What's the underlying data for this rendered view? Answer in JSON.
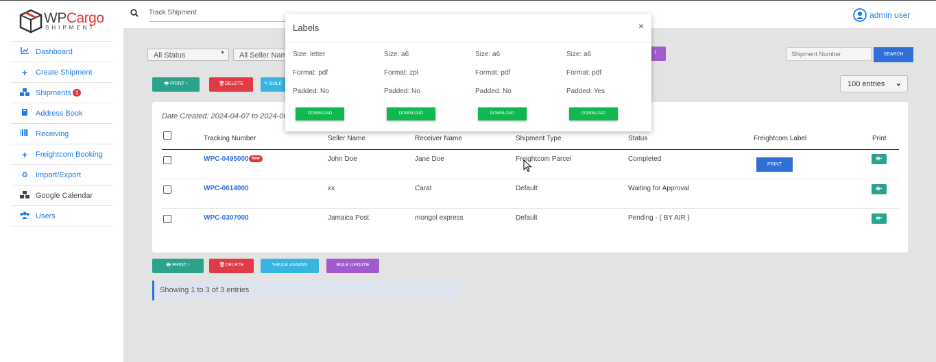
{
  "brand": {
    "name_part1": "WP",
    "name_part2": "Cargo",
    "tagline": "SHIPMENT"
  },
  "nav": [
    {
      "label": "Dashboard",
      "icon": "chart-line-icon"
    },
    {
      "label": "Create Shipment",
      "icon": "plus-icon"
    },
    {
      "label": "Shipments",
      "icon": "boxes-icon",
      "badge": "1"
    },
    {
      "label": "Address Book",
      "icon": "book-icon"
    },
    {
      "label": "Receiving",
      "icon": "barcode-icon"
    },
    {
      "label": "Freightcom Booking",
      "icon": "plus-icon"
    },
    {
      "label": "Import/Export",
      "icon": "recycle-icon"
    },
    {
      "label": "Google Calendar",
      "icon": "boxes-icon"
    },
    {
      "label": "Users",
      "icon": "users-icon"
    }
  ],
  "topbar": {
    "search_placeholder": "Track Shipment",
    "user": "admin user"
  },
  "filters": {
    "status": "All Status",
    "seller": "All Seller Name"
  },
  "toolbar": {
    "print": "PRINT",
    "delete": "DELETE",
    "bulk": "BULK",
    "bulk_assign": "BULK ASSIGN",
    "bulk_update": "BULK UPDATE"
  },
  "search": {
    "placeholder": "Shipment Number",
    "button": "SEARCH"
  },
  "entries": "100 entries",
  "date_created": "Date Created: 2024-04-07 to 2024-06-0",
  "columns": [
    "Tracking Number",
    "Seller Name",
    "Receiver Name",
    "Shipment Type",
    "Status",
    "Freightcom Label",
    "Print"
  ],
  "rows": [
    {
      "tracking": "WPC-0495000",
      "new": "New",
      "seller": "John Doe",
      "receiver": "Jane Doe",
      "type": "Freightcom Parcel",
      "status": "Completed",
      "label_btn": "PRINT"
    },
    {
      "tracking": "WPC-0614000",
      "seller": "xx",
      "receiver": "Carat",
      "type": "Default",
      "status": "Waiting for Approval"
    },
    {
      "tracking": "WPC-0307000",
      "seller": "Jamaica Post",
      "receiver": "mongol express",
      "type": "Default",
      "status": "Pending - ( BY AIR )"
    }
  ],
  "showing": "Showing 1 to 3 of 3 entries",
  "modal": {
    "title": "Labels",
    "close": "×",
    "labels": [
      {
        "size": "Size: letter",
        "format": "Format: pdf",
        "padded": "Padded: No",
        "download": "DOWNLOAD"
      },
      {
        "size": "Size: a6",
        "format": "Format: zpl",
        "padded": "Padded: No",
        "download": "DOWNLOAD"
      },
      {
        "size": "Size: a6",
        "format": "Format: pdf",
        "padded": "Padded: No",
        "download": "DOWNLOAD"
      },
      {
        "size": "Size: a6",
        "format": "Format: pdf",
        "padded": "Padded: Yes",
        "download": "DOWNLOAD"
      }
    ]
  },
  "colors": {
    "accent": "#1e7ce6",
    "print": "#2ba28c",
    "delete": "#e03a45",
    "download": "#10b84f"
  }
}
